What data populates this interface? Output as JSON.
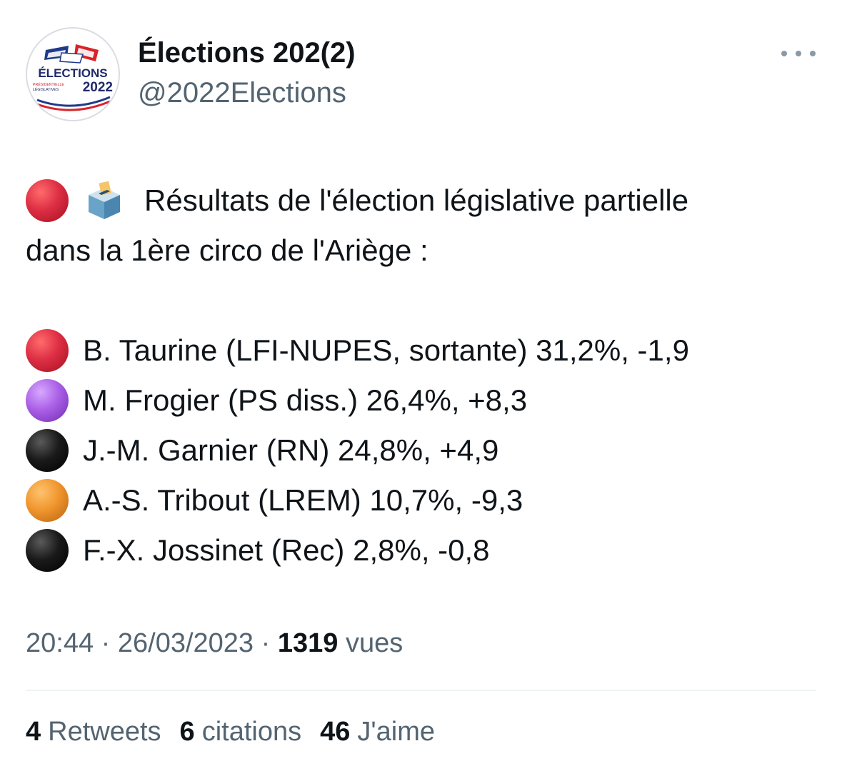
{
  "header": {
    "display_name": "Élections 202(2)",
    "handle": "@2022Elections",
    "avatar": {
      "logo_main": "ÉLECTIONS",
      "logo_sub1": "PRÉSIDENTIELLE",
      "logo_sub2": "LÉGISLATIVES",
      "logo_year": "2022"
    },
    "more_icon": "more-horizontal-icon"
  },
  "tweet": {
    "intro_line1": "Résultats de l'élection législative partielle",
    "intro_line2": "dans la 1ère circo de l'Ariège :",
    "intro_icons": [
      "red-circle-icon",
      "ballot-box-icon"
    ],
    "results": [
      {
        "text": "B. Taurine (LFI-NUPES, sortante) 31,2%, -1,9",
        "dot_icon": "red-circle-icon",
        "color": "#dd2e44"
      },
      {
        "text": "M. Frogier (PS diss.) 26,4%, +8,3",
        "dot_icon": "purple-circle-icon",
        "color": "#aa5fe6"
      },
      {
        "text": "J.-M. Garnier (RN) 24,8%, +4,9",
        "dot_icon": "black-circle-icon",
        "color": "#111111"
      },
      {
        "text": "A.-S. Tribout (LREM) 10,7%, -9,3",
        "dot_icon": "orange-circle-icon",
        "color": "#f0962e"
      },
      {
        "text": "F.-X. Jossinet (Rec) 2,8%, -0,8",
        "dot_icon": "black-circle-icon",
        "color": "#111111"
      }
    ]
  },
  "meta": {
    "time": "20:44",
    "separator": "·",
    "date": "26/03/2023",
    "views_count": "1319",
    "views_label": "vues"
  },
  "stats": {
    "retweets_count": "4",
    "retweets_label": "Retweets",
    "quotes_count": "6",
    "quotes_label": "citations",
    "likes_count": "46",
    "likes_label": "J'aime"
  },
  "colors": {
    "text": "#0f1419",
    "secondary": "#536471",
    "divider": "#eff3f4",
    "red": "#dd2e44",
    "navy": "#1f2a6b"
  }
}
